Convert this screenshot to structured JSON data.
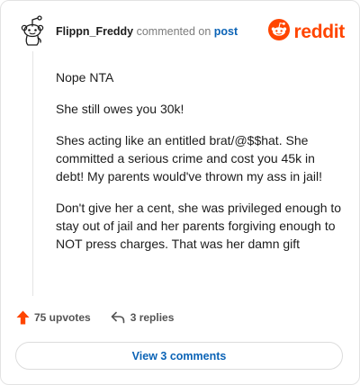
{
  "comment": {
    "username": "Flippn_Freddy",
    "action_text": "commented on",
    "post_link": "post",
    "avatar_icon": "snoo-outline-icon",
    "paragraphs": [
      "Nope NTA",
      "She still owes you 30k!",
      "Shes acting like an entitled brat/@$$hat. She committed a serious crime and cost you 45k in debt! My parents would've thrown my ass in jail!",
      "Don't give her a cent, she was privileged enough to stay out of jail and her parents forgiving enough to NOT press charges. That was her damn gift"
    ]
  },
  "branding": {
    "logo_text": "reddit",
    "logo_icon": "reddit-alien-icon",
    "brand_color": "#ff4500"
  },
  "footer": {
    "upvotes": "75 upvotes",
    "upvote_icon": "upvote-arrow-icon",
    "upvote_color": "#ff4500",
    "replies": "3 replies",
    "reply_icon": "reply-arrow-icon",
    "view_comments": "View 3 comments",
    "link_color": "#0b63b6"
  }
}
